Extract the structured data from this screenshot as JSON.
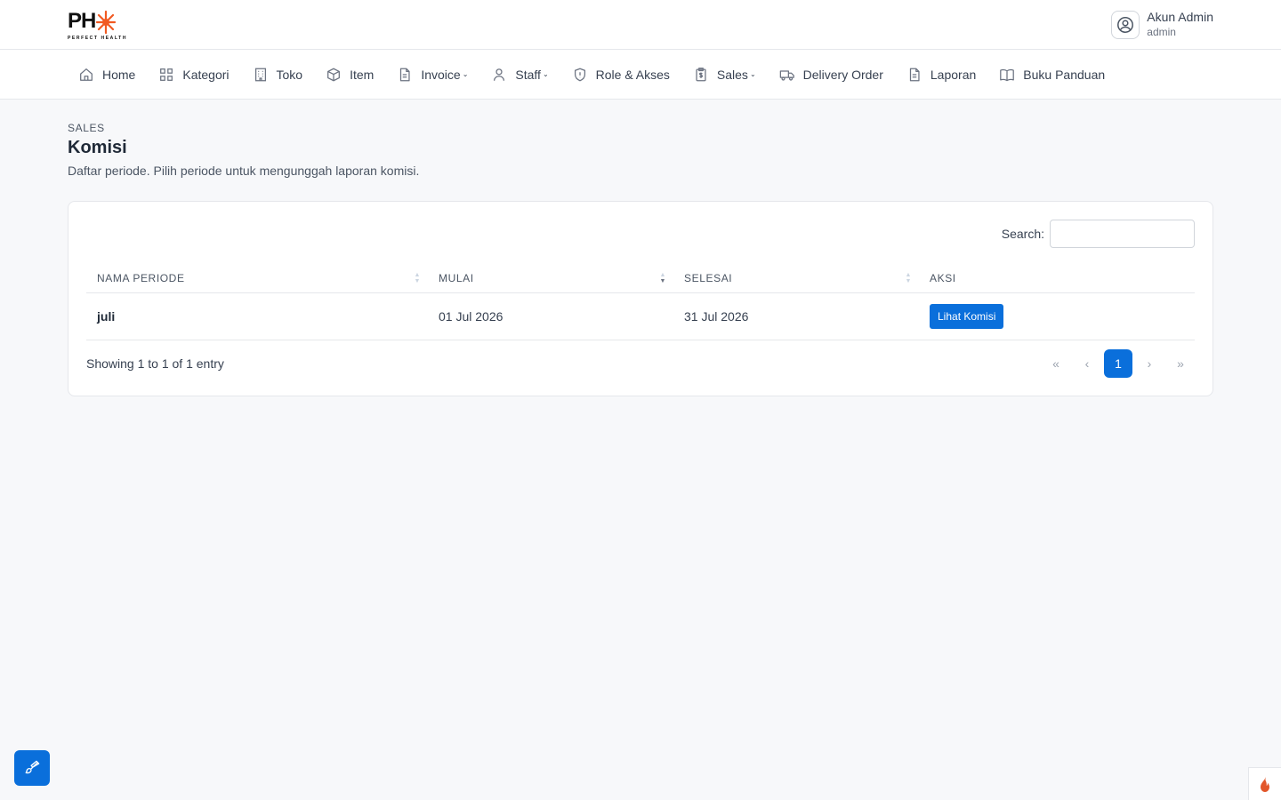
{
  "header": {
    "logo_text": "PH",
    "logo_subtext": "PERFECT HEALTH",
    "user_name": "Akun Admin",
    "user_role": "admin"
  },
  "nav": [
    {
      "label": "Home",
      "icon": "home-icon"
    },
    {
      "label": "Kategori",
      "icon": "grid-icon"
    },
    {
      "label": "Toko",
      "icon": "building-icon"
    },
    {
      "label": "Item",
      "icon": "box-icon"
    },
    {
      "label": "Invoice",
      "icon": "document-icon",
      "dropdown": true
    },
    {
      "label": "Staff",
      "icon": "user-icon",
      "dropdown": true
    },
    {
      "label": "Role & Akses",
      "icon": "shield-icon"
    },
    {
      "label": "Sales",
      "icon": "clipboard-dollar-icon",
      "dropdown": true
    },
    {
      "label": "Delivery Order",
      "icon": "truck-icon"
    },
    {
      "label": "Laporan",
      "icon": "file-icon"
    },
    {
      "label": "Buku Panduan",
      "icon": "book-icon"
    }
  ],
  "page": {
    "breadcrumb": "SALES",
    "title": "Komisi",
    "description": "Daftar periode. Pilih periode untuk mengunggah laporan komisi."
  },
  "search": {
    "label": "Search:",
    "value": ""
  },
  "table": {
    "columns": [
      "NAMA PERIODE",
      "MULAI",
      "SELESAI",
      "AKSI"
    ],
    "rows": [
      {
        "nama": "juli",
        "mulai": "01 Jul 2026",
        "selesai": "31 Jul 2026",
        "aksi": "Lihat Komisi"
      }
    ]
  },
  "pagination": {
    "info": "Showing 1 to 1 of 1 entry",
    "first": "«",
    "prev": "‹",
    "current": "1",
    "next": "›",
    "last": "»"
  },
  "colors": {
    "primary": "#0a6fdb",
    "logo_accent": "#f15a22"
  }
}
